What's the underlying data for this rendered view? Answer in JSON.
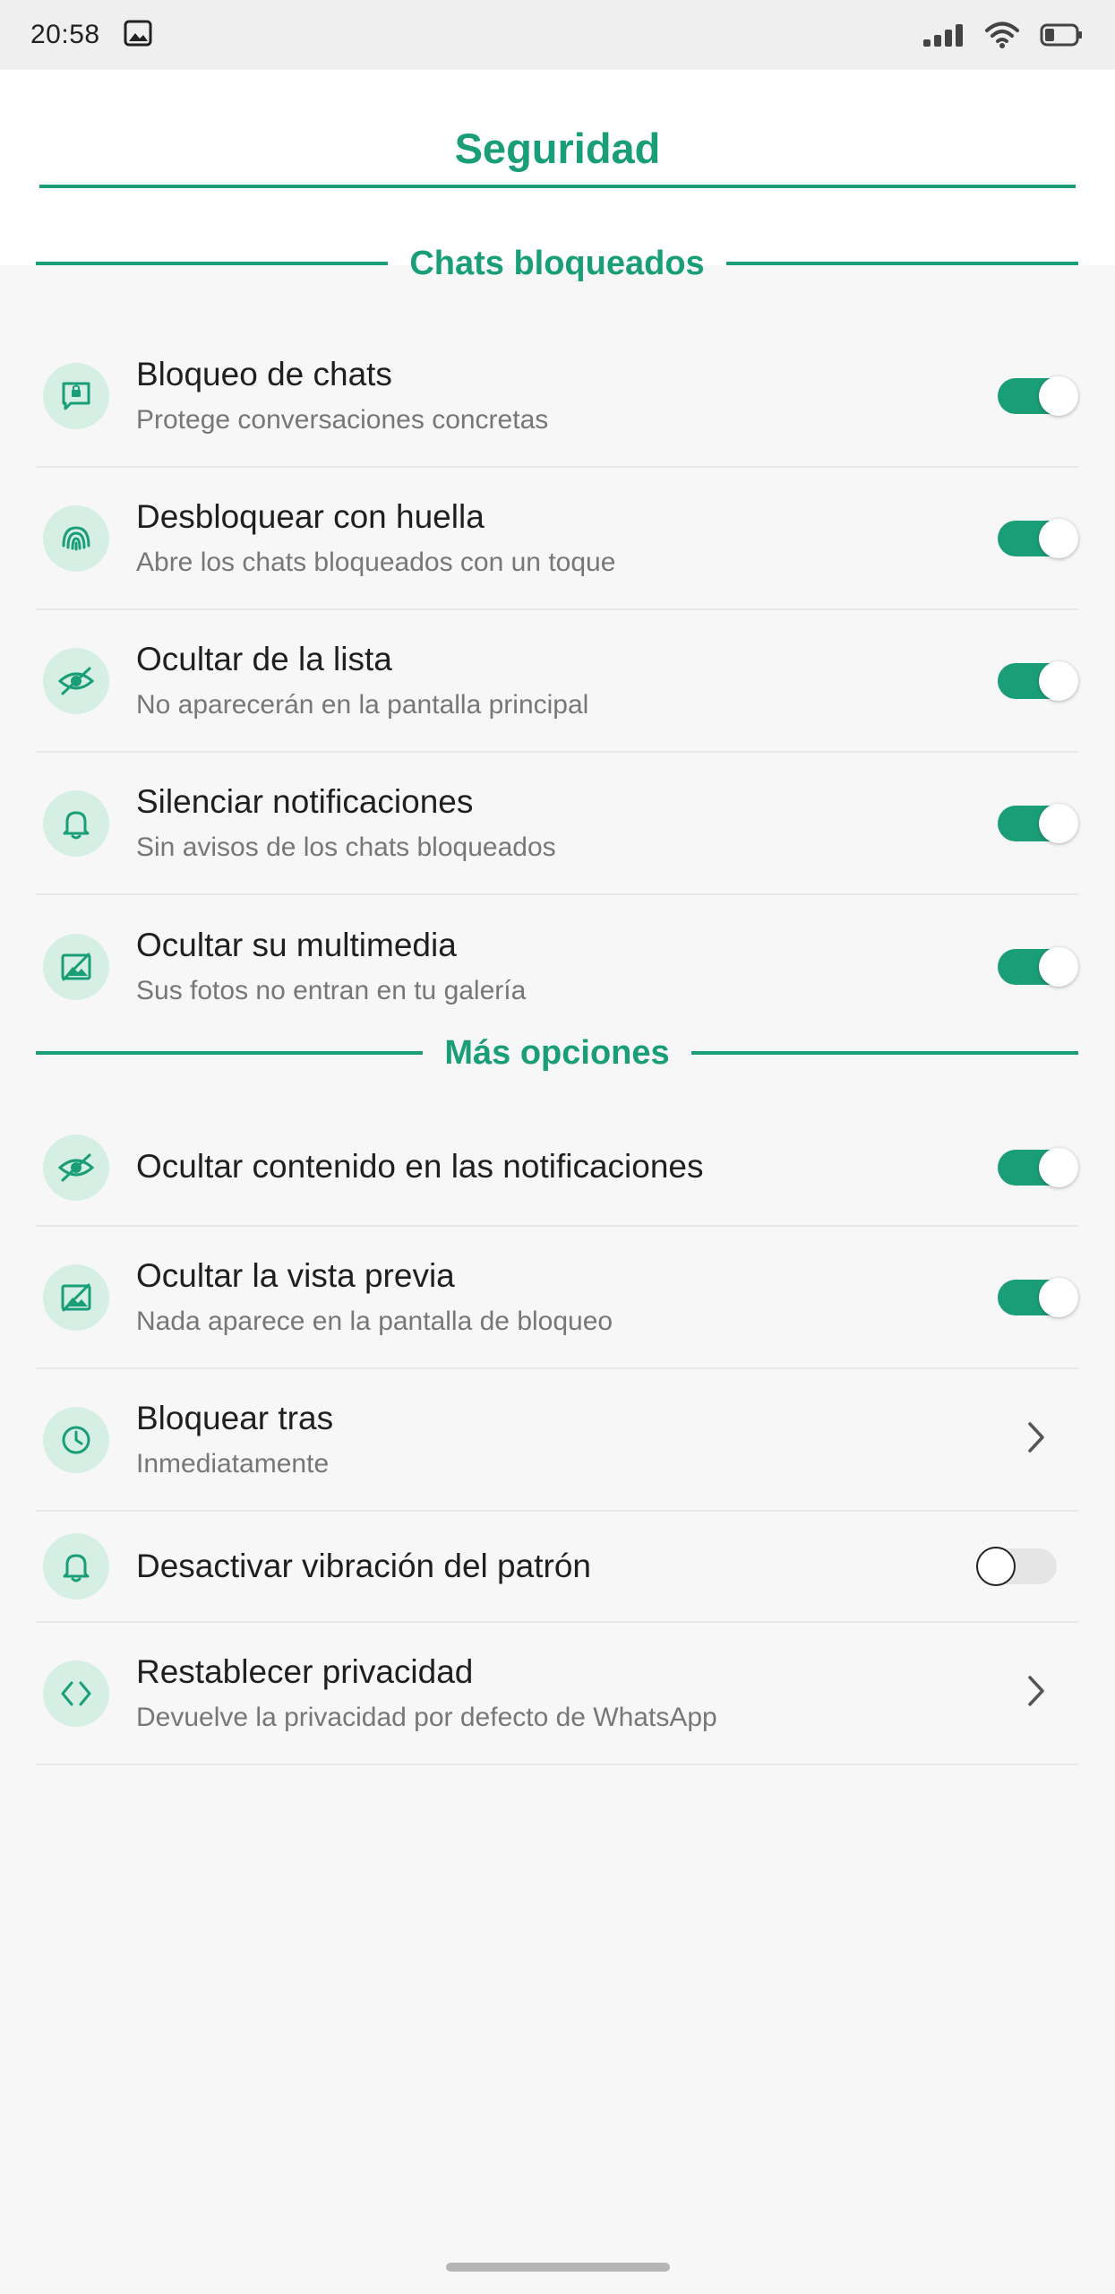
{
  "status_bar": {
    "time": "20:58",
    "icons": [
      "gallery-icon",
      "signal-icon",
      "wifi-icon",
      "battery-icon"
    ]
  },
  "header": {
    "title": "Seguridad"
  },
  "sections": {
    "blocked_chats": {
      "title": "Chats bloqueados"
    },
    "more_options": {
      "title": "Más opciones"
    }
  },
  "rows": {
    "chat_lock": {
      "icon": "chat-lock-icon",
      "title": "Bloqueo de chats",
      "subtitle": "Protege conversaciones concretas",
      "toggle": true
    },
    "fingerprint": {
      "icon": "fingerprint-icon",
      "title": "Desbloquear con huella",
      "subtitle": "Abre los chats bloqueados con un toque",
      "toggle": true
    },
    "hide_list": {
      "icon": "eye-off-icon",
      "title": "Ocultar de la lista",
      "subtitle": "No aparecerán en la pantalla principal",
      "toggle": true
    },
    "mute": {
      "icon": "bell-icon",
      "title": "Silenciar notificaciones",
      "subtitle": "Sin avisos de los chats bloqueados",
      "toggle": true
    },
    "hide_media": {
      "icon": "image-off-icon",
      "title": "Ocultar su multimedia",
      "subtitle": "Sus fotos no entran en tu galería",
      "toggle": true
    },
    "hide_notif_content": {
      "icon": "eye-off-icon",
      "title": "Ocultar contenido en las notificaciones",
      "toggle": true
    },
    "hide_preview": {
      "icon": "image-off-icon",
      "title": "Ocultar la vista previa",
      "subtitle": "Nada aparece en la pantalla de bloqueo",
      "toggle": true
    },
    "lock_after": {
      "icon": "clock-icon",
      "title": "Bloquear tras",
      "subtitle": "Inmediatamente"
    },
    "pattern_vibration": {
      "icon": "bell-icon",
      "title": "Desactivar vibración del patrón",
      "toggle": false
    },
    "reset_privacy": {
      "icon": "code-icon",
      "title": "Restablecer privacidad",
      "subtitle": "Devuelve la privacidad por defecto de WhatsApp"
    }
  },
  "colors": {
    "accent": "#1a9e78",
    "icon_bg": "#d6efe5",
    "background": "#f7f7f7"
  }
}
